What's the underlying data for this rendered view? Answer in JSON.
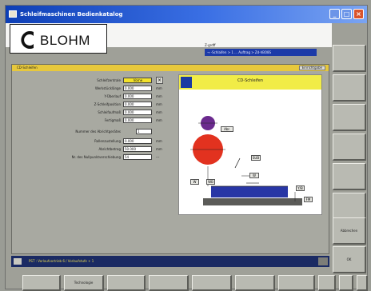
{
  "window": {
    "title": "Schleifmaschinen Bedienkatalog",
    "buttons": [
      "_",
      "□",
      "×"
    ]
  },
  "logo": {
    "text": "BLOHM"
  },
  "program": {
    "name": "Z-grdff",
    "path": "→ -Schlaifen > 1 ... Auftrag > Zd-hBO8S"
  },
  "panel": {
    "title": "CD-Schleifen",
    "change_button": "Einrichtgabe",
    "image_title": "CD-Schleifen",
    "params": [
      {
        "label": "Schleifzentrale",
        "value": "Vorne",
        "unit": ""
      },
      {
        "label": "Werkstücklänge",
        "value": "0.000",
        "unit": "mm"
      },
      {
        "label": "Y-Überlauf",
        "value": "0.000",
        "unit": "mm"
      },
      {
        "label": "Z-Schleifposition",
        "value": "0.000",
        "unit": "mm"
      },
      {
        "label": "Schleifaufmaß",
        "value": "0.000",
        "unit": "mm"
      },
      {
        "label": "Fertigmaß",
        "value": "0.000",
        "unit": "mm"
      },
      {
        "label": "Nummer des Abrichtgerätes",
        "value": "1",
        "unit": ""
      },
      {
        "label": "Rollenzustellung",
        "value": "0.000",
        "unit": "mm"
      },
      {
        "label": "Abrichtbetrag",
        "value": "50.000",
        "unit": "mm"
      },
      {
        "label": "Nr. des Nullpunktverschiebung",
        "value": "54",
        "unit": "---"
      }
    ]
  },
  "diagram_labels": {
    "dresser": "Abr.",
    "wheel": "S",
    "feed_z": "SUB",
    "feed_x": "W",
    "left_a": "W",
    "left_b": "WB",
    "overrun": "Y/B",
    "fin": "FM"
  },
  "right_softkeys": [
    "",
    "",
    "",
    "",
    "",
    "",
    "",
    "Abbrechen",
    "OK"
  ],
  "bottom_softkeys": [
    "",
    "Technologie",
    "",
    "",
    "",
    "",
    "",
    "",
    "",
    ""
  ],
  "status": {
    "text": "PST : Vorlaufvortrieb 6 / Vorlaufstufe + 1"
  },
  "colors": {
    "wheel": "#e2321f",
    "dresser": "#6b2a8e",
    "workpiece": "#2836a5",
    "header_yellow": "#f1ec47",
    "panel_head": "#e7c83c"
  }
}
